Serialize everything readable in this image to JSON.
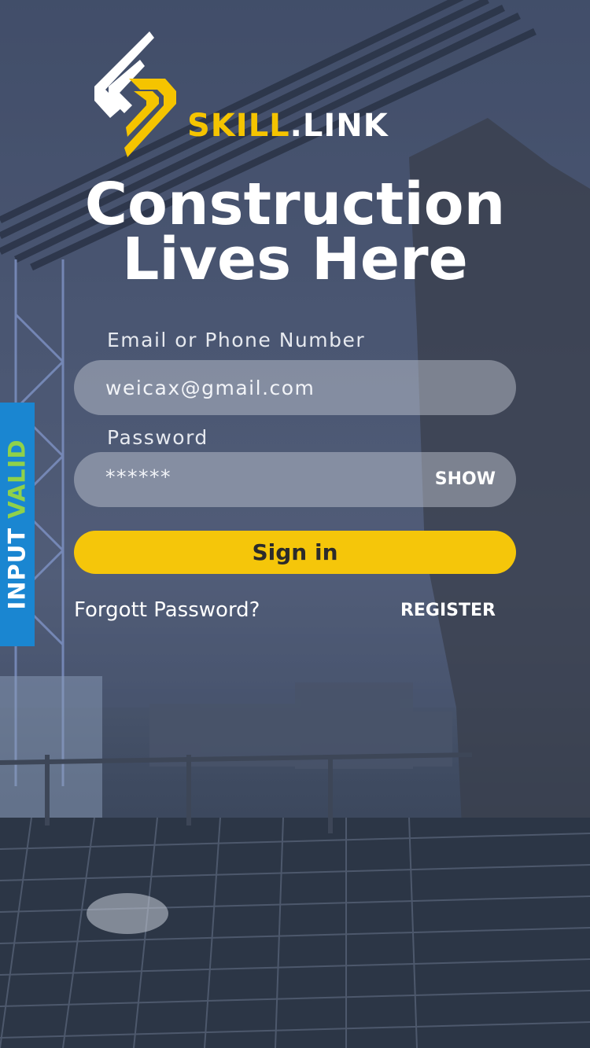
{
  "brand": {
    "name_part1": "SKILL",
    "name_part2": ".LINK",
    "icon": "skill-link-logo-mark",
    "accent_color": "#f5c400"
  },
  "headline": {
    "line1": "Construction",
    "line2": "Lives Here"
  },
  "login": {
    "email_label": "Email or Phone Number",
    "email_value": "weicax@gmail.com",
    "password_label": "Password",
    "password_value": "******",
    "show_label": "SHOW",
    "signin_label": "Sign in",
    "signin_color": "#f5c60a"
  },
  "links": {
    "forgot_label": "Forgott Password?",
    "register_label": "REGISTER"
  },
  "validation_badge": {
    "word1": "INPUT",
    "word2": "VALID",
    "badge_color": "#1a86d1",
    "valid_color": "#8fd14a"
  }
}
